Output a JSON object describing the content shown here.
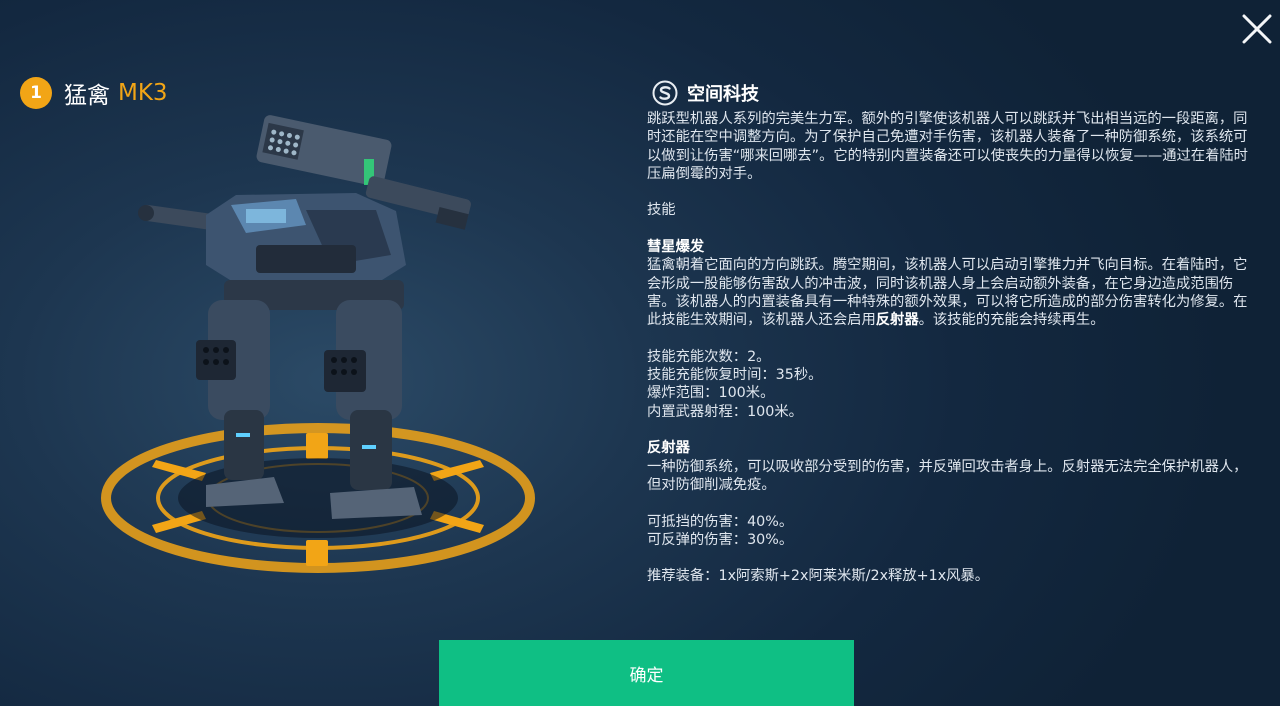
{
  "robot": {
    "rank": "1",
    "name": "猛禽",
    "mark": "MK3"
  },
  "brand": {
    "icon": "space-tech-logo-icon",
    "name": "空间科技"
  },
  "description": {
    "intro": "跳跃型机器人系列的完美生力军。额外的引擎使该机器人可以跳跃并飞出相当远的一段距离，同时还能在空中调整方向。为了保护自己免遭对手伤害，该机器人装备了一种防御系统，该系统可以做到让伤害“哪来回哪去”。它的特别内置装备还可以使丧失的力量得以恢复——通过在着陆时压扁倒霉的对手。",
    "skills_heading": "技能",
    "ability": {
      "name": "彗星爆发",
      "text_before": "猛禽朝着它面向的方向跳跃。腾空期间，该机器人可以启动引擎推力并飞向目标。在着陆时，它会形成一股能够伤害敌人的冲击波，同时该机器人身上会启动额外装备，在它身边造成范围伤害。该机器人的内置装备具有一种特殊的额外效果，可以将它所造成的部分伤害转化为修复。在此技能生效期间，该机器人还会启用",
      "text_bold": "反射器",
      "text_after": "。该技能的充能会持续再生。",
      "stats": [
        "技能充能次数：2。",
        "技能充能恢复时间：35秒。",
        "爆炸范围：100米。",
        "内置武器射程：100米。"
      ]
    },
    "reflector": {
      "name": "反射器",
      "text": "一种防御系统，可以吸收部分受到的伤害，并反弹回攻击者身上。反射器无法完全保护机器人，但对防御削减免疫。",
      "stats": [
        "可抵挡的伤害：40%。",
        "可反弹的伤害：30%。"
      ]
    },
    "recommended": "推荐装备：1x阿索斯+2x阿莱米斯/2x释放+1x风暴。"
  },
  "buttons": {
    "confirm": "确定",
    "close_icon": "close-icon"
  },
  "colors": {
    "accent_orange": "#f2a516",
    "confirm_green": "#0fbf84",
    "background": "#1a3350"
  }
}
